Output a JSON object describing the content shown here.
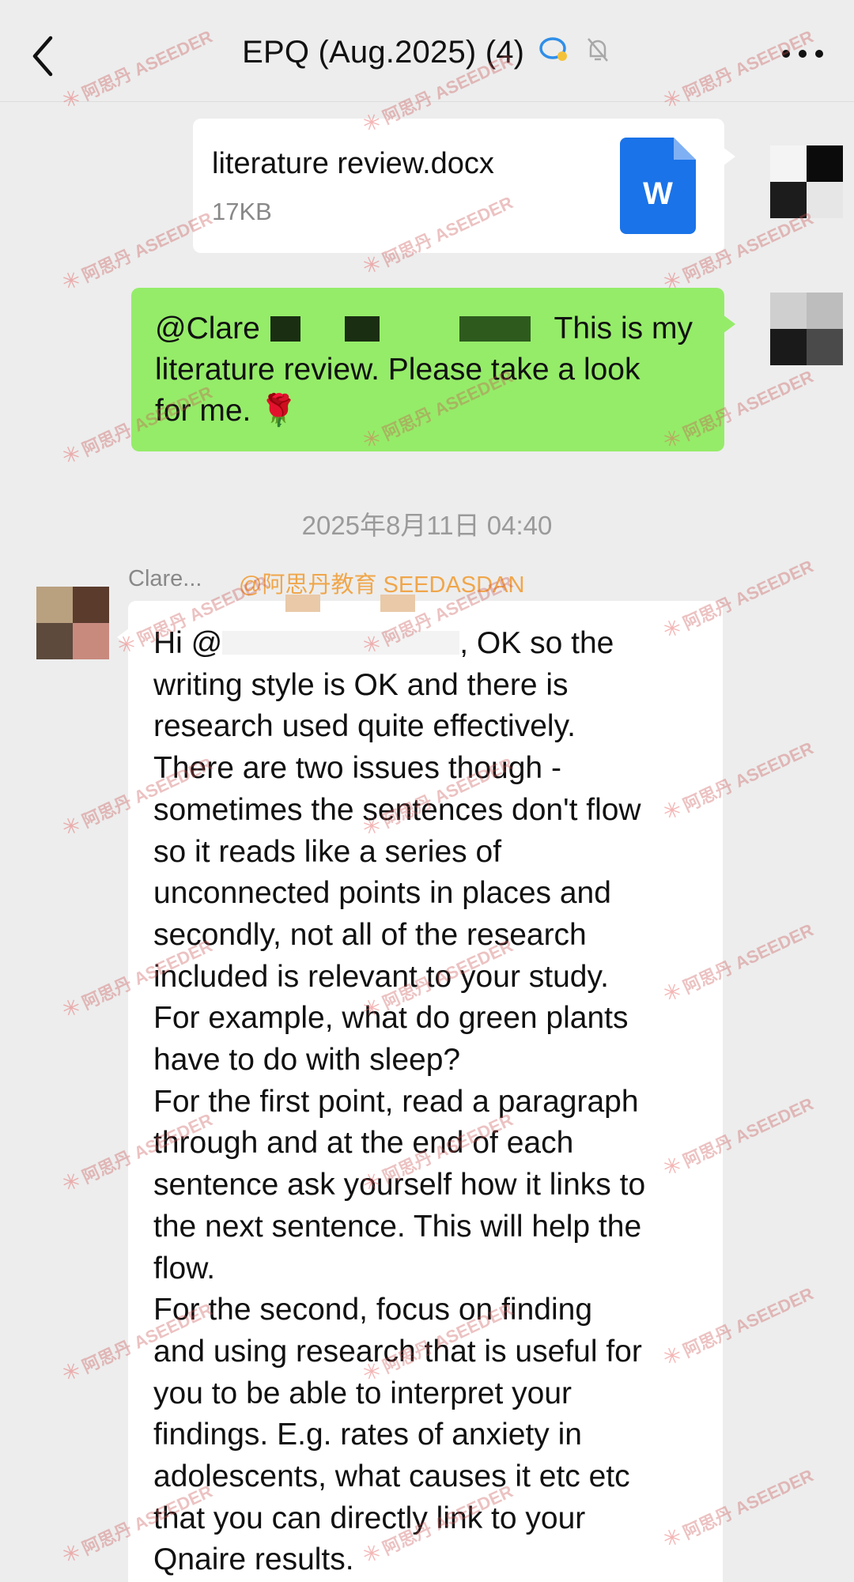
{
  "header": {
    "title": "EPQ (Aug.2025) (4)",
    "back_icon": "chevron-left-icon",
    "more_icon": "ellipsis-icon",
    "chat_icon": "chat-bubble-icon",
    "mute_icon": "bell-off-icon"
  },
  "messages": {
    "file": {
      "name": "literature review.docx",
      "size": "17KB",
      "badge": "W",
      "badge_color": "#1a73e8"
    },
    "green": {
      "mention": "@Clare",
      "line1_tail": "This is my",
      "line2": "literature review. Please take a look",
      "line3": "for me. 🌹"
    },
    "timestamp": "2025年8月11日 04:40",
    "reply": {
      "sender": "Clare...",
      "tag": "@阿思丹教育 SEEDASDAN",
      "greeting_start": "Hi @",
      "greeting_end": ", OK so the",
      "lines": [
        "writing style is OK and there is",
        "research used quite effectively.",
        "There are two issues though -",
        "sometimes the sentences don't flow",
        "so it reads like a series of",
        "unconnected points in places and",
        "secondly, not all of the research",
        "included is relevant to your study.",
        "For example, what do green plants",
        "have to do with sleep?",
        "For the first point, read a paragraph",
        "through and at the end of each",
        "sentence ask yourself how it links to",
        "the next sentence. This will help the",
        "flow.",
        "For the second, focus on finding",
        "and using research that is useful for",
        "you to be able to interpret your",
        "findings. E.g. rates of anxiety in",
        "adolescents, what causes it etc etc",
        "that you can directly link to your",
        "Qnaire results."
      ]
    }
  },
  "watermark": {
    "text": "阿思丹 ASEEDER"
  },
  "colors": {
    "bg": "#ededed",
    "green_bubble": "#95ec69",
    "tag": "#f0a64a"
  }
}
